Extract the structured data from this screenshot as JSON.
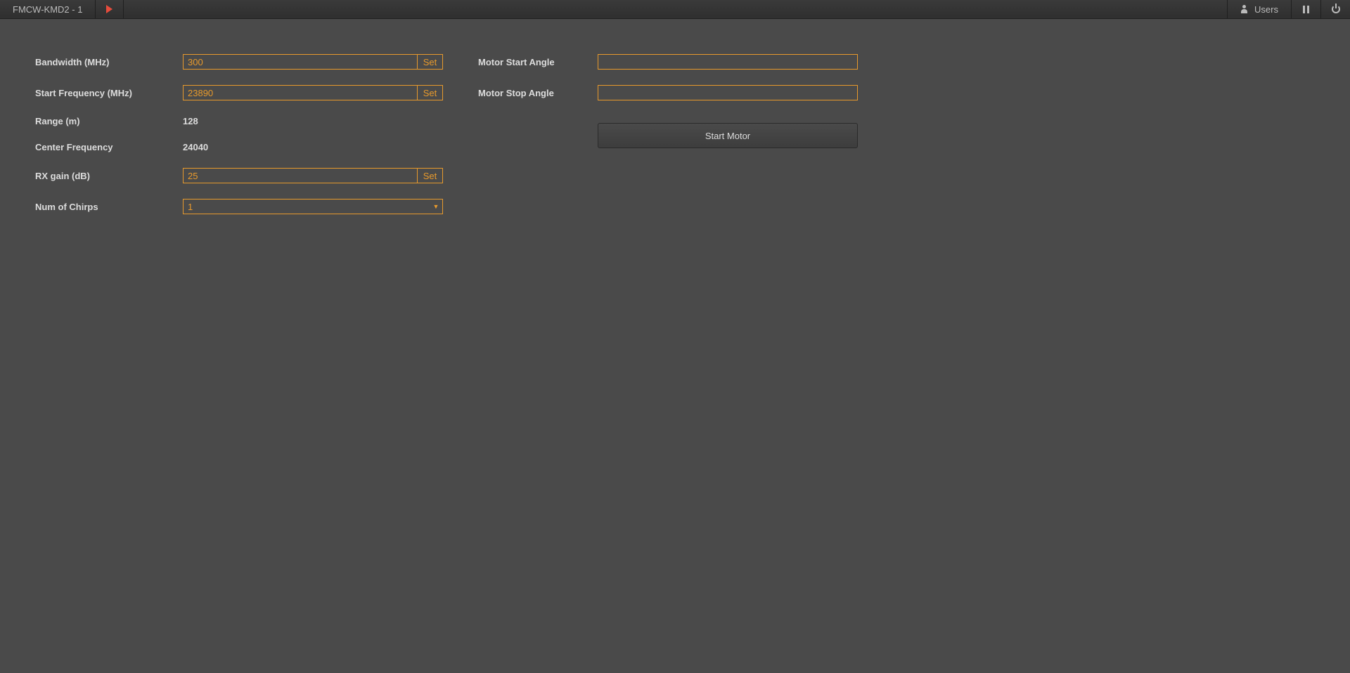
{
  "topbar": {
    "tab_title": "FMCW-KMD2 - 1",
    "users_label": "Users"
  },
  "form": {
    "bandwidth": {
      "label": "Bandwidth (MHz)",
      "value": "300",
      "set": "Set"
    },
    "start_freq": {
      "label": "Start Frequency (MHz)",
      "value": "23890",
      "set": "Set"
    },
    "range": {
      "label": "Range (m)",
      "value": "128"
    },
    "center_freq": {
      "label": "Center Frequency",
      "value": "24040"
    },
    "rx_gain": {
      "label": "RX gain (dB)",
      "value": "25",
      "set": "Set"
    },
    "num_chirps": {
      "label": "Num of Chirps",
      "value": "1"
    },
    "motor_start_angle": {
      "label": "Motor Start Angle",
      "value": ""
    },
    "motor_stop_angle": {
      "label": "Motor Stop Angle",
      "value": ""
    },
    "start_motor_btn": "Start Motor"
  }
}
